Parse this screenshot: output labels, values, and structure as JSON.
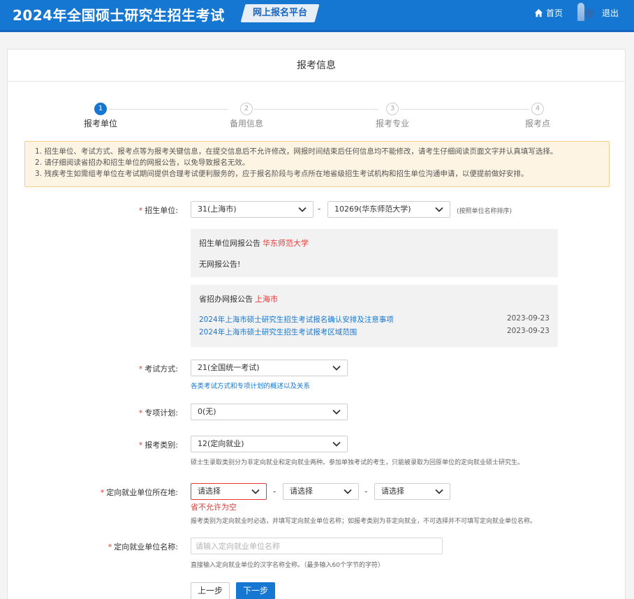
{
  "header": {
    "title": "2024年全国硕士研究生招生考试",
    "platform": "网上报名平台",
    "home": "首页",
    "logout": "退出"
  },
  "card_title": "报考信息",
  "steps": [
    {
      "num": "1",
      "label": "报考单位",
      "active": true
    },
    {
      "num": "2",
      "label": "备用信息",
      "active": false
    },
    {
      "num": "3",
      "label": "报考专业",
      "active": false
    },
    {
      "num": "4",
      "label": "报考点",
      "active": false
    }
  ],
  "notice": [
    "1. 招生单位、考试方式、报考点等为报考关键信息，在提交信息后不允许修改，网报时间结束后任何信息均不能修改，请考生仔细阅读页面文字并认真填写选择。",
    "2. 请仔细阅读省招办和招生单位的网报公告，以免导致报名无效。",
    "3. 残疾考生如需组考单位在考试期间提供合理考试便利服务的，应于报名阶段与考点所在地省级招生考试机构和招生单位沟通申请，以便提前做好安排。"
  ],
  "form": {
    "unit": {
      "label": "招生单位:",
      "province": "31(上海市)",
      "school": "10269(华东师范大学)",
      "sort_hint": "(按照单位名称排序)"
    },
    "school_announcement": {
      "label": "招生单位网报公告",
      "school": "华东师范大学",
      "body": "无网报公告!"
    },
    "province_announcement": {
      "label": "省招办网报公告",
      "province": "上海市",
      "items": [
        {
          "title": "2024年上海市硕士研究生招生考试报名确认安排及注意事项",
          "date": "2023-09-23"
        },
        {
          "title": "2024年上海市硕士研究生招生考试报考区域范围",
          "date": "2023-09-23"
        }
      ]
    },
    "exam_mode": {
      "label": "考试方式:",
      "value": "21(全国统一考试)",
      "link": "各类考试方式和专项计划的概述以及关系"
    },
    "special_plan": {
      "label": "专项计划:",
      "value": "0(无)"
    },
    "category": {
      "label": "报考类别:",
      "value": "12(定向就业)",
      "hint": "硕士生录取类别分为非定向就业和定向就业两种。参加单独考试的考生，只能被录取为回原单位的定向就业硕士研究生。"
    },
    "employer_location": {
      "label": "定向就业单位所在地:",
      "select1": "请选择",
      "select2": "请选择",
      "select3": "请选择",
      "error": "省不允许为空",
      "hint": "报考类别为定向就业时必选，并填写定向就业单位名称；如报考类别为非定向就业，不可选择并不可填写定向就业单位名称。"
    },
    "employer_name": {
      "label": "定向就业单位名称:",
      "placeholder": "请输入定向就业单位名称",
      "hint": "直接输入定向就业单位的汉字名称全称。（最多输入60个字节的字符）"
    }
  },
  "buttons": {
    "prev": "上一步",
    "next": "下一步"
  },
  "colors": {
    "primary": "#1677d2",
    "error": "#e53935",
    "notice_bg": "#fdf4e3"
  }
}
